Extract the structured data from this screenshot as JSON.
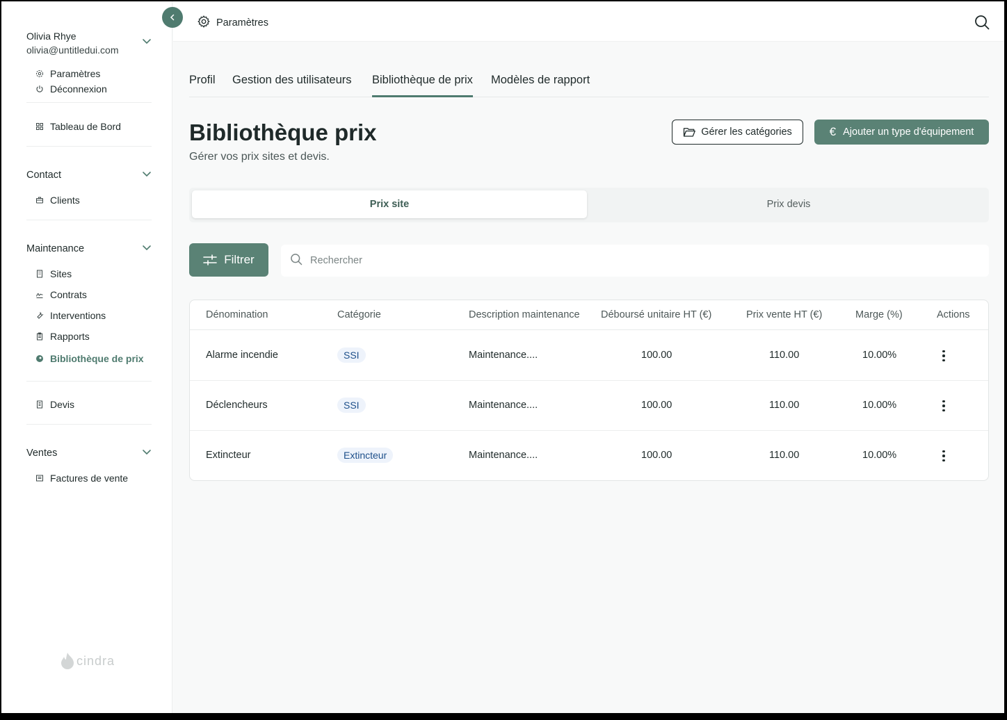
{
  "user": {
    "name": "Olivia Rhye",
    "email": "olivia@untitledui.com"
  },
  "sidebar": {
    "account_items": [
      {
        "label": "Paramètres",
        "icon": "gear-icon"
      },
      {
        "label": "Déconnexion",
        "icon": "power-icon"
      }
    ],
    "dashboard": {
      "label": "Tableau de Bord",
      "icon": "grid-icon"
    },
    "contact": {
      "title": "Contact",
      "items": [
        {
          "label": "Clients",
          "icon": "briefcase-icon"
        }
      ]
    },
    "maintenance": {
      "title": "Maintenance",
      "items": [
        {
          "label": "Sites",
          "icon": "building-icon"
        },
        {
          "label": "Contrats",
          "icon": "signature-icon"
        },
        {
          "label": "Interventions",
          "icon": "wrench-icon"
        },
        {
          "label": "Rapports",
          "icon": "clipboard-icon"
        },
        {
          "label": "Bibliothèque de prix",
          "icon": "price-icon",
          "active": true
        }
      ]
    },
    "devis": {
      "label": "Devis",
      "icon": "document-icon"
    },
    "ventes": {
      "title": "Ventes",
      "items": [
        {
          "label": "Factures de vente",
          "icon": "invoice-icon"
        }
      ]
    },
    "logo": "cindra"
  },
  "topbar": {
    "title": "Paramètres"
  },
  "tabs": [
    {
      "label": "Profil"
    },
    {
      "label": "Gestion des utilisateurs"
    },
    {
      "label": "Bibliothèque de prix",
      "active": true
    },
    {
      "label": "Modèles de rapport"
    }
  ],
  "page": {
    "title": "Bibliothèque prix",
    "subtitle": "Gérer vos prix sites et devis.",
    "manage_categories_label": "Gérer les catégories",
    "add_equipment_label": "Ajouter un type d'équipement"
  },
  "segments": [
    {
      "label": "Prix site",
      "active": true
    },
    {
      "label": "Prix devis"
    }
  ],
  "filter_label": "Filtrer",
  "search": {
    "placeholder": "Rechercher",
    "value": ""
  },
  "table": {
    "columns": [
      "Dénomination",
      "Catégorie",
      "Description maintenance",
      "Déboursé unitaire HT (€)",
      "Prix vente HT (€)",
      "Marge (%)",
      "Actions"
    ],
    "rows": [
      {
        "name": "Alarme incendie",
        "category": "SSI",
        "description": "Maintenance....",
        "cost": "100.00",
        "price": "110.00",
        "margin": "10.00%"
      },
      {
        "name": "Déclencheurs",
        "category": "SSI",
        "description": "Maintenance....",
        "cost": "100.00",
        "price": "110.00",
        "margin": "10.00%"
      },
      {
        "name": "Extincteur",
        "category": "Extincteur",
        "description": "Maintenance....",
        "cost": "100.00",
        "price": "110.00",
        "margin": "10.00%"
      }
    ]
  },
  "colors": {
    "accent": "#5a8275",
    "badge_bg": "#eef3fb",
    "badge_text": "#1d4f8a"
  }
}
